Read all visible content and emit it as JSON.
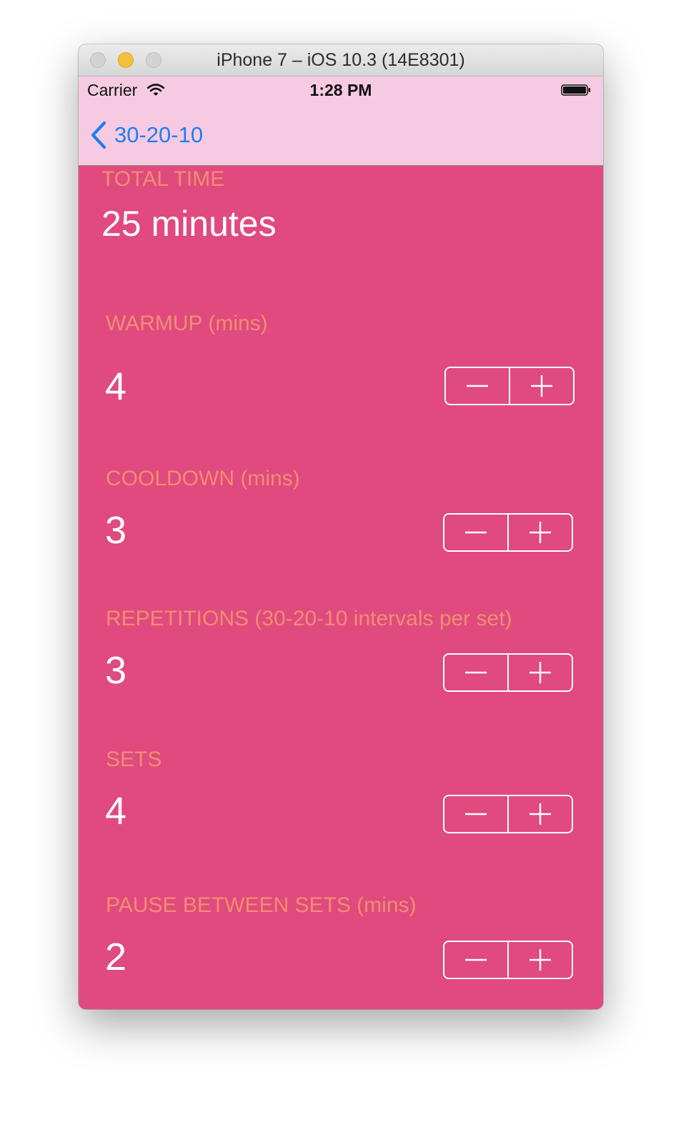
{
  "window": {
    "title": "iPhone 7 – iOS 10.3 (14E8301)"
  },
  "status_bar": {
    "carrier": "Carrier",
    "time": "1:28 PM"
  },
  "nav": {
    "back_label": "30-20-10"
  },
  "total": {
    "label": "TOTAL TIME",
    "value": "25 minutes"
  },
  "settings": [
    {
      "label": "WARMUP (mins)",
      "value": "4"
    },
    {
      "label": "COOLDOWN (mins)",
      "value": "3"
    },
    {
      "label": "REPETITIONS (30-20-10 intervals per set)",
      "value": "3"
    },
    {
      "label": "SETS",
      "value": "4"
    },
    {
      "label": "PAUSE BETWEEN SETS (mins)",
      "value": "2"
    }
  ],
  "colors": {
    "background": "#e04a7e",
    "nav_background": "#f6cbe1",
    "caption": "#f28d72",
    "tint": "#1f7cf5",
    "value_text": "#ffffff"
  },
  "icons": {
    "back": "chevron-left-icon",
    "wifi": "wifi-icon",
    "battery": "battery-icon",
    "decrement": "minus-icon",
    "increment": "plus-icon"
  }
}
